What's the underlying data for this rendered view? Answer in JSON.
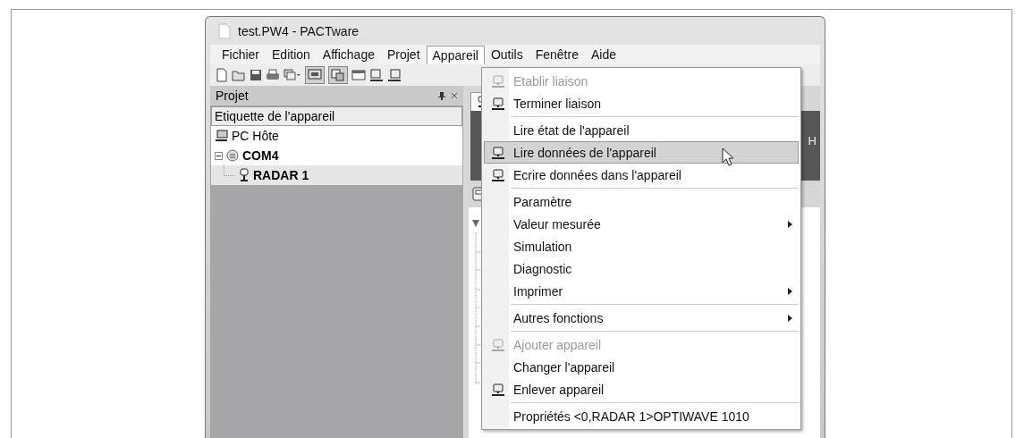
{
  "window": {
    "title": "test.PW4 - PACTware"
  },
  "menubar": [
    {
      "label": "Fichier",
      "selected": false
    },
    {
      "label": "Edition",
      "selected": false
    },
    {
      "label": "Affichage",
      "selected": false
    },
    {
      "label": "Projet",
      "selected": false
    },
    {
      "label": "Appareil",
      "selected": true
    },
    {
      "label": "Outils",
      "selected": false
    },
    {
      "label": "Fenêtre",
      "selected": false
    },
    {
      "label": "Aide",
      "selected": false
    }
  ],
  "project_panel": {
    "title": "Projet",
    "column": "Etiquette de l'appareil",
    "tree": [
      {
        "kind": "host",
        "label": "PC Hôte",
        "selected": false
      },
      {
        "kind": "port",
        "label": "COM4",
        "selected": false,
        "expanded": true,
        "children": [
          {
            "kind": "device",
            "label": "RADAR 1",
            "selected": true
          }
        ]
      }
    ]
  },
  "banner": {
    "text": "H"
  },
  "menu": {
    "items": [
      {
        "kind": "item",
        "label": "Etablir liaison",
        "icon": true,
        "disabled": true,
        "selected": false,
        "submenu": false
      },
      {
        "kind": "item",
        "label": "Terminer liaison",
        "icon": true,
        "disabled": false,
        "selected": false,
        "submenu": false
      },
      {
        "kind": "separator"
      },
      {
        "kind": "item",
        "label": "Lire état de l'appareil",
        "icon": false,
        "disabled": false,
        "selected": false,
        "submenu": false
      },
      {
        "kind": "item",
        "label": "Lire données de l'appareil",
        "icon": true,
        "disabled": false,
        "selected": true,
        "submenu": false
      },
      {
        "kind": "item",
        "label": "Ecrire données dans l'appareil",
        "icon": true,
        "disabled": false,
        "selected": false,
        "submenu": false
      },
      {
        "kind": "separator"
      },
      {
        "kind": "item",
        "label": "Paramètre",
        "icon": false,
        "disabled": false,
        "selected": false,
        "submenu": false
      },
      {
        "kind": "item",
        "label": "Valeur mesurée",
        "icon": false,
        "disabled": false,
        "selected": false,
        "submenu": true
      },
      {
        "kind": "item",
        "label": "Simulation",
        "icon": false,
        "disabled": false,
        "selected": false,
        "submenu": false
      },
      {
        "kind": "item",
        "label": "Diagnostic",
        "icon": false,
        "disabled": false,
        "selected": false,
        "submenu": false
      },
      {
        "kind": "item",
        "label": "Imprimer",
        "icon": false,
        "disabled": false,
        "selected": false,
        "submenu": true
      },
      {
        "kind": "separator"
      },
      {
        "kind": "item",
        "label": "Autres fonctions",
        "icon": false,
        "disabled": false,
        "selected": false,
        "submenu": true
      },
      {
        "kind": "separator"
      },
      {
        "kind": "item",
        "label": "Ajouter appareil",
        "icon": true,
        "disabled": true,
        "selected": false,
        "submenu": false
      },
      {
        "kind": "item",
        "label": "Changer l'appareil",
        "icon": false,
        "disabled": false,
        "selected": false,
        "submenu": false
      },
      {
        "kind": "item",
        "label": "Enlever appareil",
        "icon": true,
        "disabled": false,
        "selected": false,
        "submenu": false
      },
      {
        "kind": "separator"
      },
      {
        "kind": "item",
        "label": "Propriétés <0,RADAR 1>OPTIWAVE 1010",
        "icon": false,
        "disabled": false,
        "selected": false,
        "submenu": false
      }
    ]
  }
}
